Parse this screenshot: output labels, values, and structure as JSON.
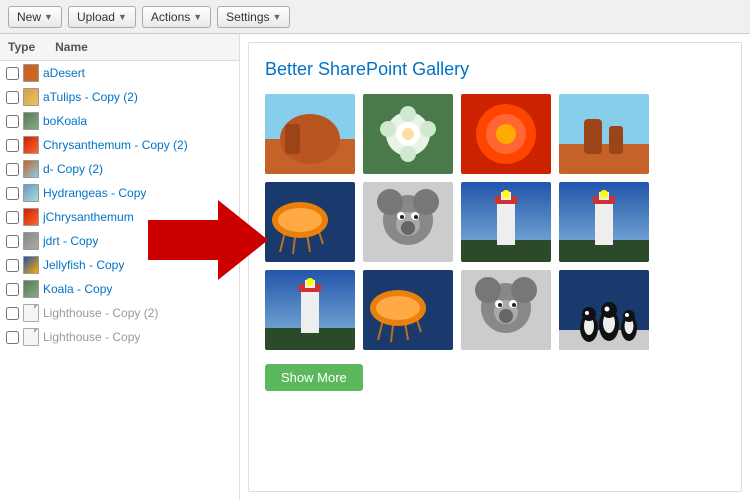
{
  "toolbar": {
    "new_label": "New",
    "upload_label": "Upload",
    "actions_label": "Actions",
    "settings_label": "Settings"
  },
  "sidebar": {
    "col_type": "Type",
    "col_name": "Name",
    "items": [
      {
        "name": "aDesert",
        "faded": false,
        "has_thumb": true
      },
      {
        "name": "aTulips - Copy (2)",
        "faded": false,
        "has_thumb": true
      },
      {
        "name": "boKoala",
        "faded": false,
        "has_thumb": true
      },
      {
        "name": "Chrysanthemum - Copy (2)",
        "faded": false,
        "has_thumb": true
      },
      {
        "name": "d- Copy (2)",
        "faded": false,
        "has_thumb": true
      },
      {
        "name": "Hydrangeas - Copy",
        "faded": false,
        "has_thumb": true
      },
      {
        "name": "jChrysanthemum",
        "faded": false,
        "has_thumb": true
      },
      {
        "name": "jdrt - Copy",
        "faded": false,
        "has_thumb": true
      },
      {
        "name": "Jellyfish - Copy",
        "faded": false,
        "has_thumb": true
      },
      {
        "name": "Koala - Copy",
        "faded": false,
        "has_thumb": true
      },
      {
        "name": "Lighthouse - Copy (2)",
        "faded": true,
        "has_thumb": false
      },
      {
        "name": "Lighthouse - Copy",
        "faded": true,
        "has_thumb": false
      }
    ]
  },
  "gallery": {
    "title": "Better SharePoint Gallery",
    "show_more_label": "Show More",
    "images": [
      {
        "label": "Desert",
        "color1": "#c4622a",
        "color2": "#8b4513",
        "color3": "#d2691e"
      },
      {
        "label": "Hydrangeas",
        "color1": "#5a8a5a",
        "color2": "#7fbf7f",
        "color3": "#a8d5a8"
      },
      {
        "label": "Chrysanthemum",
        "color1": "#cc2200",
        "color2": "#ff4400",
        "color3": "#ff6633"
      },
      {
        "label": "Desert2",
        "color1": "#c4622a",
        "color2": "#8b4513",
        "color3": "#87ceeb"
      },
      {
        "label": "Jellyfish",
        "color1": "#1a3a6e",
        "color2": "#2255aa",
        "color3": "#ff8800"
      },
      {
        "label": "Koala",
        "color1": "#888",
        "color2": "#aaa",
        "color3": "#ccc"
      },
      {
        "label": "Lighthouse",
        "color1": "#2255aa",
        "color2": "#88bbdd",
        "color3": "#336699"
      },
      {
        "label": "Lighthouse2",
        "color1": "#5577aa",
        "color2": "#88aacc",
        "color3": "#aaccee"
      },
      {
        "label": "Lighthouse3",
        "color1": "#2a4a7a",
        "color2": "#336699",
        "color3": "#aaccee"
      },
      {
        "label": "Jellyfish2",
        "color1": "#1a2a6e",
        "color2": "#2255aa",
        "color3": "#ffaa00"
      },
      {
        "label": "Koala2",
        "color1": "#777",
        "color2": "#999",
        "color3": "#bbb"
      },
      {
        "label": "Penguins",
        "color1": "#1a3a6e",
        "color2": "#2255aa",
        "color3": "#eee"
      }
    ]
  }
}
